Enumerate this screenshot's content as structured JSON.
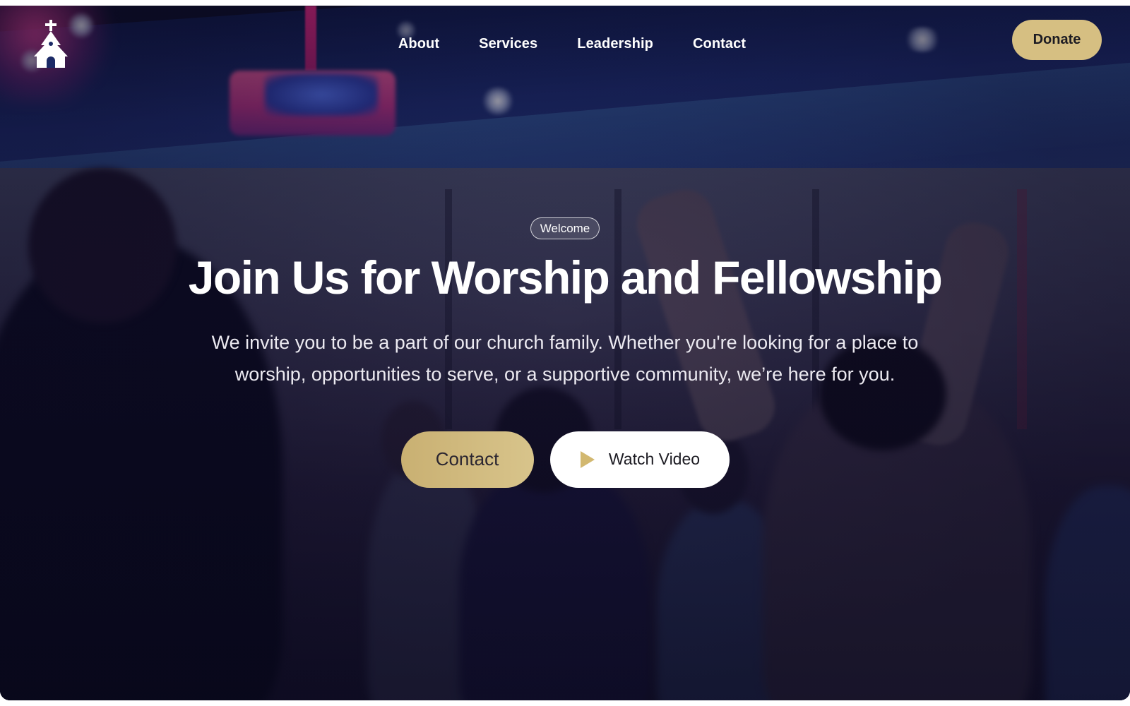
{
  "header": {
    "logo_icon": "church-icon",
    "nav": [
      {
        "label": "About"
      },
      {
        "label": "Services"
      },
      {
        "label": "Leadership"
      },
      {
        "label": "Contact"
      }
    ],
    "donate_label": "Donate"
  },
  "hero": {
    "badge": "Welcome",
    "title": "Join Us for Worship and Fellowship",
    "subtitle": "We invite you to be a part of our church family. Whether you're looking for a place to worship, opportunities to serve, or a supportive community, we’re here for you.",
    "primary_cta": "Contact",
    "secondary_cta": "Watch Video",
    "secondary_cta_icon": "play-icon"
  },
  "colors": {
    "accent_gold": "#d6bf82",
    "text_light": "#ffffff",
    "button_white": "#ffffff"
  }
}
